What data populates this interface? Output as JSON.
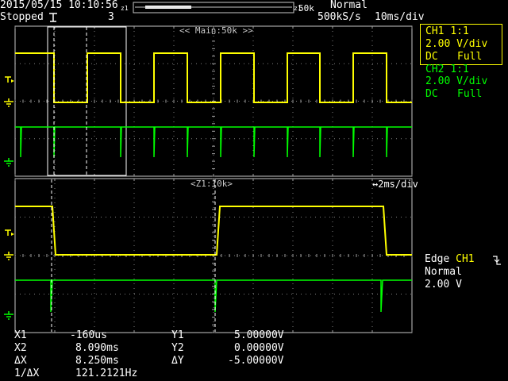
{
  "header": {
    "date_time": "2015/05/15 10:10:56",
    "run_state": "Stopped",
    "record_num": "3",
    "mode": "Normal",
    "sample_rate": "500kS/s",
    "timebase": "10ms/div",
    "memory_label": "50k"
  },
  "main_window": {
    "label": "<< Main:50k >>"
  },
  "zoom_window": {
    "label": "<Z1:10k>",
    "timebase": "↔2ms/div"
  },
  "ch1": {
    "name": "CH1",
    "probe": "1:1",
    "vdiv": "2.00 V/div",
    "coupling": "DC",
    "bandwidth": "Full",
    "color": "#ffff00"
  },
  "ch2": {
    "name": "CH2",
    "probe": "1:1",
    "vdiv": "2.00 V/div",
    "coupling": "DC",
    "bandwidth": "Full",
    "color": "#00ff00"
  },
  "trigger": {
    "type": "Edge",
    "source": "CH1",
    "slope_icon": "falling-edge-icon",
    "mode": "Normal",
    "level": "2.00 V"
  },
  "markers": {
    "ch1_level": "1",
    "ch1_ground": "1",
    "ch2_ground": "2",
    "trigger": "T"
  },
  "cursors": {
    "x1_label": "X1",
    "x1": "-160us",
    "x2_label": "X2",
    "x2": "8.090ms",
    "dx_label": "ΔX",
    "dx": "8.250ms",
    "inv_dx_label": "1/ΔX",
    "inv_dx": "121.2121Hz",
    "y1_label": "Y1",
    "y1": "5.00000V",
    "y2_label": "Y2",
    "y2": "0.00000V",
    "dy_label": "ΔY",
    "dy": "-5.00000V"
  }
}
